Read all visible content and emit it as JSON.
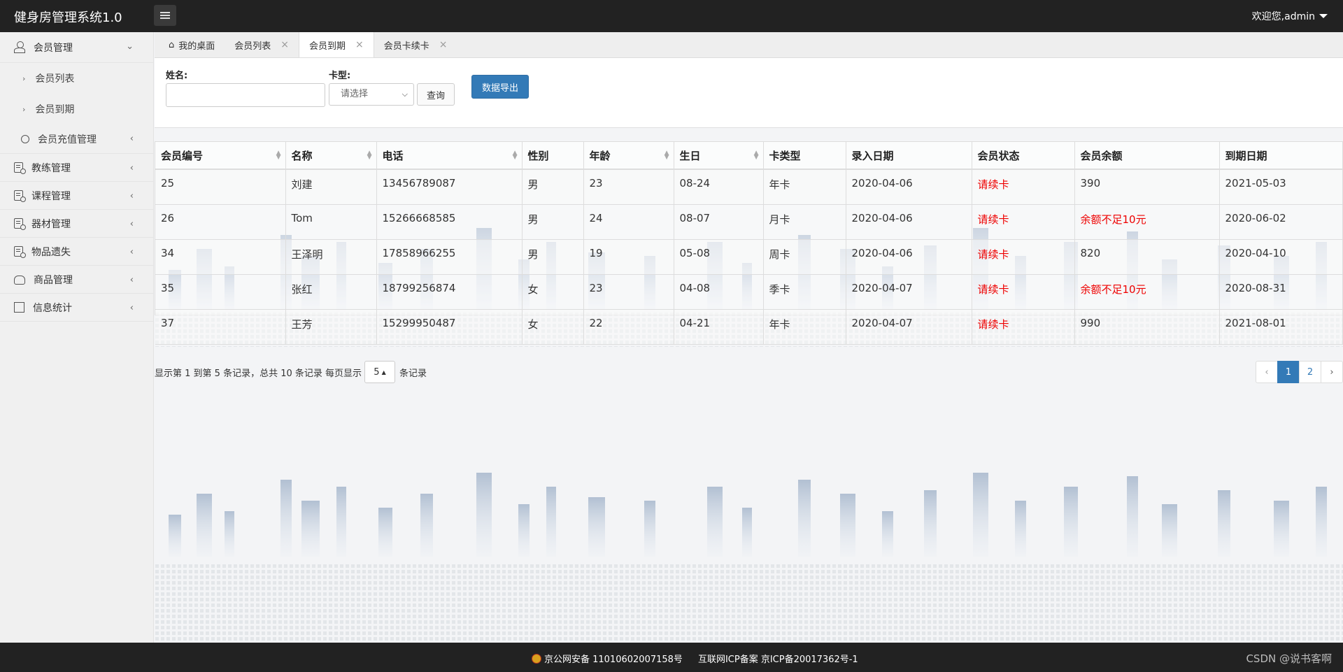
{
  "app": {
    "title": "健身房管理系统1.0",
    "welcome": "欢迎您,admin"
  },
  "sidebar": {
    "groups": [
      {
        "label": "会员管理",
        "icon": "user-icon",
        "expanded": true,
        "children": [
          {
            "label": "会员列表"
          },
          {
            "label": "会员到期"
          },
          {
            "label": "会员充值管理"
          }
        ]
      },
      {
        "label": "教练管理",
        "icon": "doc-icon"
      },
      {
        "label": "课程管理",
        "icon": "doc-icon"
      },
      {
        "label": "器材管理",
        "icon": "doc-icon"
      },
      {
        "label": "物品遗失",
        "icon": "doc-icon"
      },
      {
        "label": "商品管理",
        "icon": "bag-icon"
      },
      {
        "label": "信息统计",
        "icon": "grid-icon"
      }
    ]
  },
  "tabs": [
    {
      "label": "我的桌面",
      "closable": false
    },
    {
      "label": "会员列表",
      "closable": true
    },
    {
      "label": "会员到期",
      "closable": true,
      "active": true
    },
    {
      "label": "会员卡续卡",
      "closable": true
    }
  ],
  "filter": {
    "name_label": "姓名:",
    "name_value": "",
    "card_label": "卡型:",
    "card_selected": "请选择",
    "query_button": "查询",
    "export_button": "数据导出"
  },
  "table": {
    "columns": [
      "会员编号",
      "名称",
      "电话",
      "性别",
      "年龄",
      "生日",
      "卡类型",
      "录入日期",
      "会员状态",
      "会员余额",
      "到期日期"
    ],
    "sortable": [
      true,
      true,
      true,
      false,
      true,
      true,
      false,
      false,
      false,
      false,
      false
    ],
    "rows": [
      [
        "25",
        "刘建",
        "13456789087",
        "男",
        "23",
        "08-24",
        "年卡",
        "2020-04-06",
        "请续卡",
        "390",
        "2021-05-03"
      ],
      [
        "26",
        "Tom",
        "15266668585",
        "男",
        "24",
        "08-07",
        "月卡",
        "2020-04-06",
        "请续卡",
        "余额不足10元",
        "2020-06-02"
      ],
      [
        "34",
        "王泽明",
        "17858966255",
        "男",
        "19",
        "05-08",
        "周卡",
        "2020-04-06",
        "请续卡",
        "820",
        "2020-04-10"
      ],
      [
        "35",
        "张红",
        "18799256874",
        "女",
        "23",
        "04-08",
        "季卡",
        "2020-04-07",
        "请续卡",
        "余额不足10元",
        "2020-08-31"
      ],
      [
        "37",
        "王芳",
        "15299950487",
        "女",
        "22",
        "04-21",
        "年卡",
        "2020-04-07",
        "请续卡",
        "990",
        "2021-08-01"
      ]
    ],
    "alert_color": "#ee0000"
  },
  "pager": {
    "info_prefix": "显示第 1 到第 5 条记录，总共 10 条记录 每页显示",
    "page_size": "5",
    "info_suffix": "条记录",
    "prev": "‹",
    "pages": [
      "1",
      "2"
    ],
    "current": "1",
    "next": "›"
  },
  "footer": {
    "police_record": "京公网安备 11010602007158号",
    "icp_record": "互联网ICP备案 京ICP备20017362号-1",
    "csdn": "CSDN @说书客啊"
  },
  "colors": {
    "topbar": "#222222",
    "primary": "#337ab7",
    "alert": "#ee0000"
  }
}
